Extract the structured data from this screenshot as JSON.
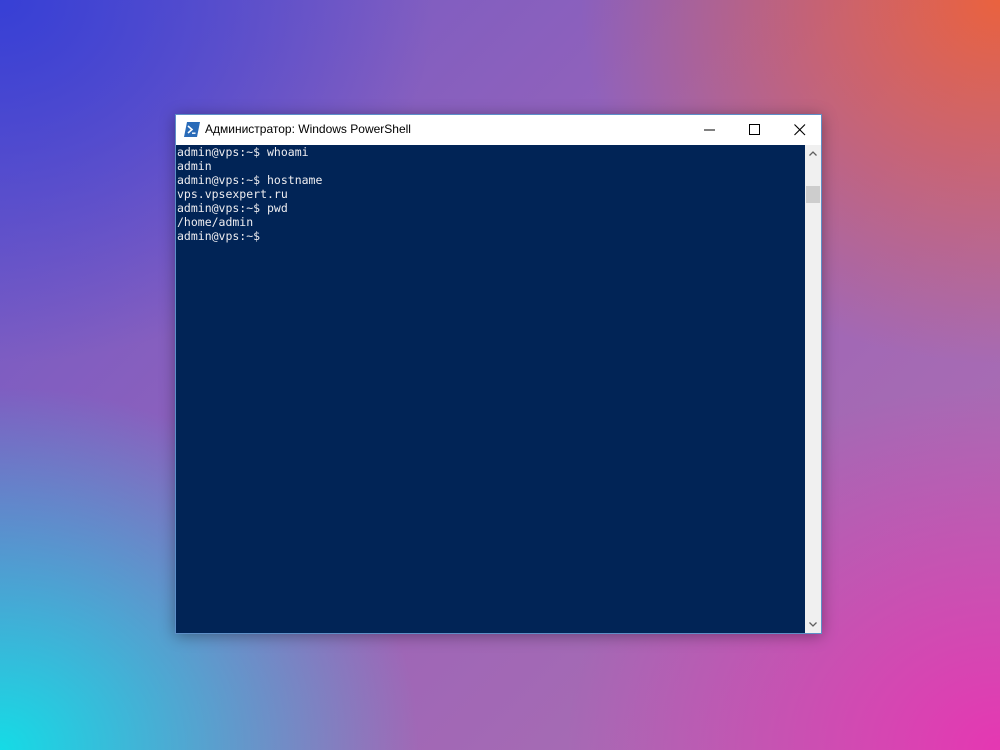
{
  "window": {
    "title": "Администратор: Windows PowerShell",
    "icon": "powershell-icon",
    "controls": {
      "minimize": "minimize-icon",
      "maximize": "maximize-icon",
      "close": "close-icon"
    }
  },
  "console": {
    "background": "#012456",
    "foreground": "#eeedf0",
    "lines": [
      "admin@vps:~$ whoami",
      "admin",
      "admin@vps:~$ hostname",
      "vps.vpsexpert.ru",
      "admin@vps:~$ pwd",
      "/home/admin",
      "admin@vps:~$"
    ]
  },
  "scrollbar": {
    "up_icon": "chevron-up-icon",
    "down_icon": "chevron-down-icon"
  },
  "colors": {
    "powershell_blue": "#2a6bb8",
    "console_bg": "#012456"
  }
}
